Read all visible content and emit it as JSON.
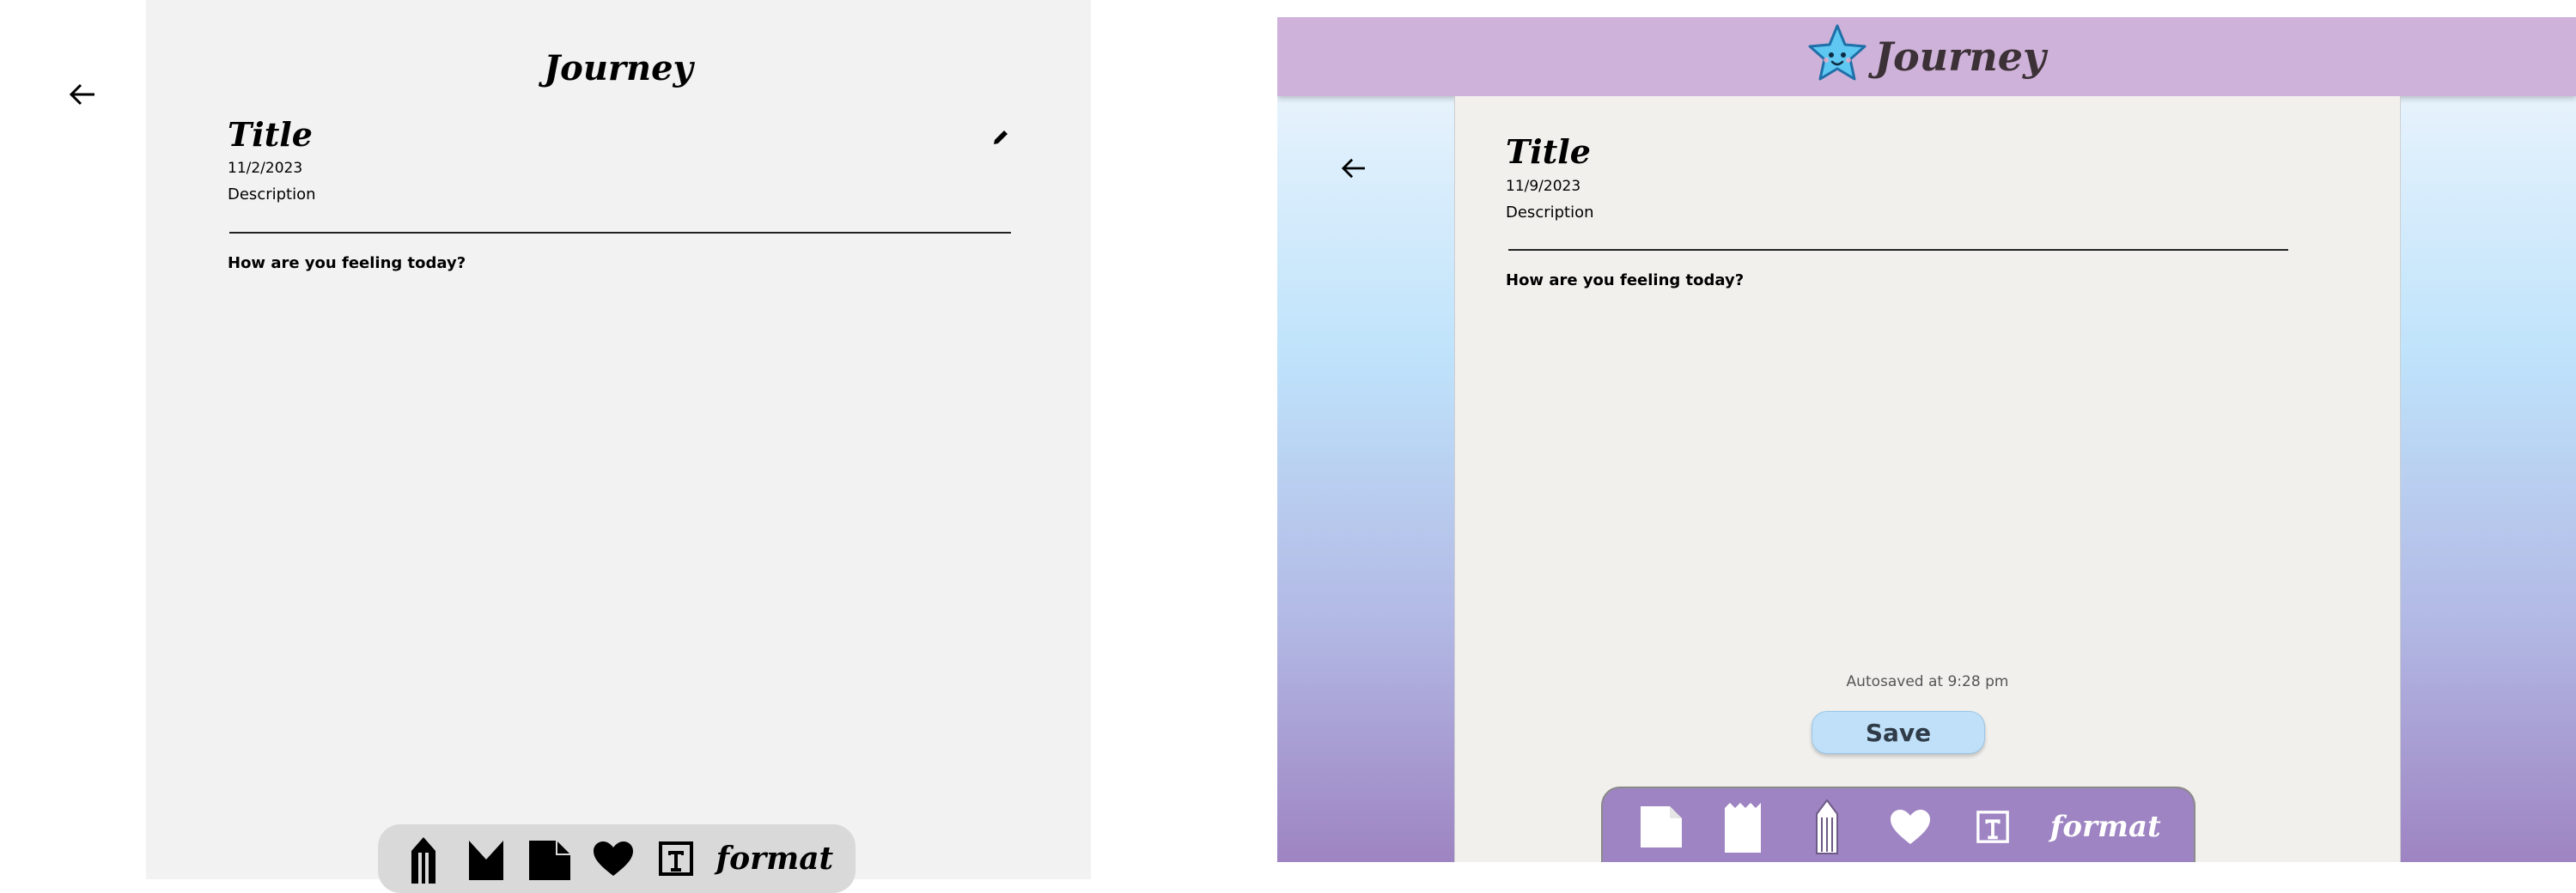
{
  "wireframe": {
    "brand": "Journey",
    "title": "Title",
    "date": "11/2/2023",
    "description": "Description",
    "prompt": "How are you feeling today?",
    "toolbar": {
      "icons": [
        "pencil-icon",
        "bookmark-icon",
        "note-icon",
        "heart-icon",
        "text-icon"
      ],
      "format_label": "format"
    }
  },
  "mockup": {
    "brand": "Journey",
    "title": "Title",
    "date": "11/9/2023",
    "description": "Description",
    "prompt": "How are you feeling today?",
    "autosave_text": "Autosaved at 9:28 pm",
    "save_label": "Save",
    "toolbar": {
      "icons": [
        "note-icon",
        "notepad-icon",
        "pencil-icon",
        "heart-icon",
        "text-icon"
      ],
      "format_label": "format"
    },
    "colors": {
      "header": "#cfb2d9",
      "toolbar": "#9e84c2",
      "save_button": "#bfe0f8",
      "paper": "#f1f0ed"
    }
  }
}
